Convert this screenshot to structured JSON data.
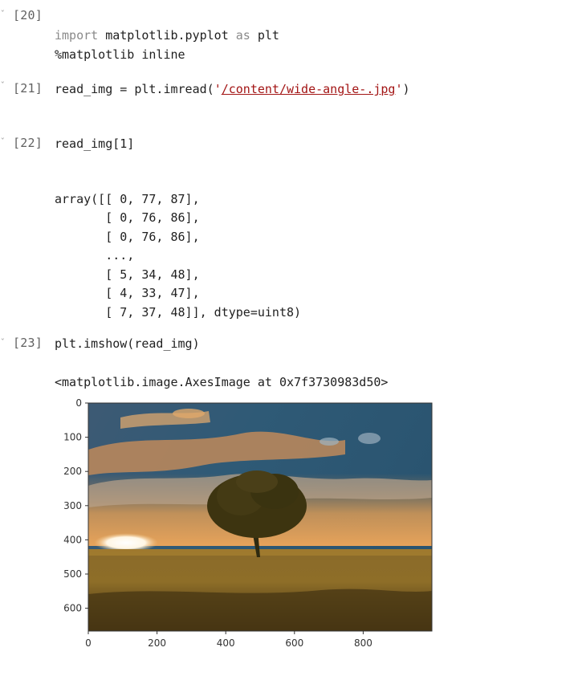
{
  "cells": [
    {
      "prompt": "[20]",
      "lines": [
        {
          "kw": "import",
          "rest": " matplotlib.pyplot ",
          "kw2": "as",
          "rest2": " plt"
        },
        {
          "plain": "%matplotlib inline"
        }
      ]
    },
    {
      "prompt": "[21]",
      "code_prefix": "read_img = plt.imread(",
      "q1": "'",
      "path": "/content/wide-angle-.jpg",
      "q2": "'",
      "code_suffix": ")"
    },
    {
      "prompt": "[22]",
      "code": "read_img[1]",
      "output": [
        "array([[ 0, 77, 87],",
        "       [ 0, 76, 86],",
        "       [ 0, 76, 86],",
        "       ...,",
        "       [ 5, 34, 48],",
        "       [ 4, 33, 47],",
        "       [ 7, 37, 48]], dtype=uint8)"
      ]
    },
    {
      "prompt": "[23]",
      "code": "plt.imshow(read_img)",
      "output": "<matplotlib.image.AxesImage at 0x7f3730983d50>"
    }
  ],
  "plot": {
    "y_ticks": [
      "0",
      "100",
      "200",
      "300",
      "400",
      "500",
      "600"
    ],
    "x_ticks": [
      "0",
      "200",
      "400",
      "600",
      "800"
    ],
    "image_description": "landscape photo: lone tree on grassy field under sunset sky"
  },
  "colors": {
    "string": "#a31515",
    "keyword": "#8a8a8a",
    "prompt": "#616161"
  },
  "chevron_icon": "chevron-collapse-icon"
}
